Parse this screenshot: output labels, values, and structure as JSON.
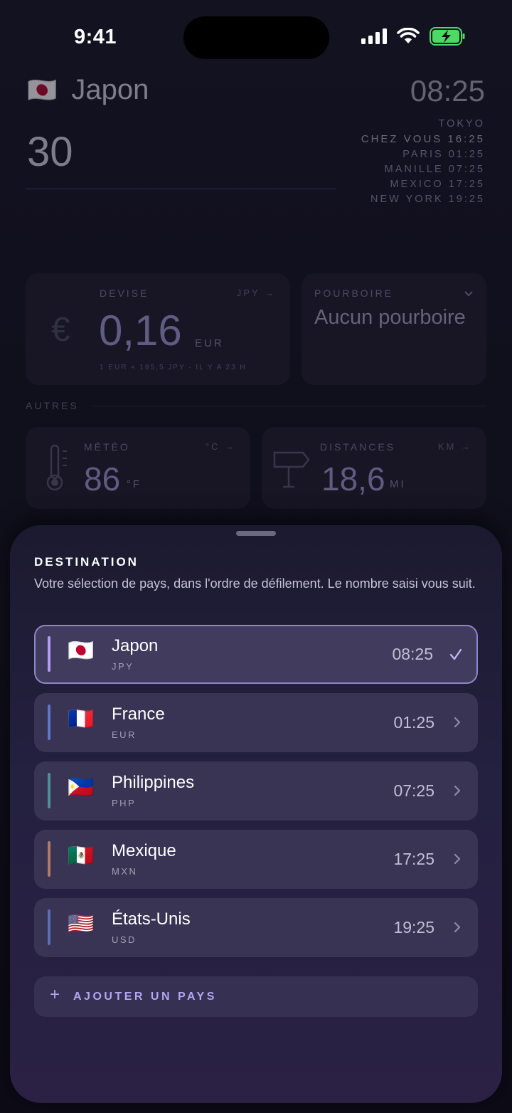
{
  "status_bar": {
    "time": "9:41"
  },
  "header": {
    "flag": "🇯🇵",
    "country": "Japon",
    "amount": "30",
    "clock": "08:25",
    "timezones": [
      {
        "label": "TOKYO",
        "time": ""
      },
      {
        "label": "CHEZ VOUS",
        "time": "16:25"
      },
      {
        "label": "PARIS",
        "time": "01:25"
      },
      {
        "label": "MANILLE",
        "time": "07:25"
      },
      {
        "label": "MEXICO",
        "time": "17:25"
      },
      {
        "label": "NEW YORK",
        "time": "19:25"
      }
    ]
  },
  "cards": {
    "currency": {
      "label": "DEVISE",
      "unit": "JPY →",
      "symbol": "€",
      "value": "0,16",
      "value_unit": "EUR",
      "note": "1 EUR ≈ 185,5 JPY  ·  IL Y A 23 H"
    },
    "tip": {
      "label": "POURBOIRE",
      "value": "Aucun pourboire"
    },
    "others_label": "AUTRES",
    "weather": {
      "label": "MÉTÉO",
      "unit": "°C →",
      "value": "86",
      "value_unit": "°F"
    },
    "distance": {
      "label": "DISTANCES",
      "unit": "KM →",
      "value": "18,6",
      "value_unit": "MI"
    }
  },
  "sheet": {
    "title": "DESTINATION",
    "description": "Votre sélection de pays, dans l'ordre de défilement. Le nombre saisi vous suit.",
    "countries": [
      {
        "flag": "🇯🇵",
        "name": "Japon",
        "code": "JPY",
        "time": "08:25",
        "selected": true,
        "bar_color": "#b19cf5"
      },
      {
        "flag": "🇫🇷",
        "name": "France",
        "code": "EUR",
        "time": "01:25",
        "selected": false,
        "bar_color": "#5d78c9"
      },
      {
        "flag": "🇵🇭",
        "name": "Philippines",
        "code": "PHP",
        "time": "07:25",
        "selected": false,
        "bar_color": "#4f8f96"
      },
      {
        "flag": "🇲🇽",
        "name": "Mexique",
        "code": "MXN",
        "time": "17:25",
        "selected": false,
        "bar_color": "#b27a6a"
      },
      {
        "flag": "🇺🇸",
        "name": "États-Unis",
        "code": "USD",
        "time": "19:25",
        "selected": false,
        "bar_color": "#5a6fb8"
      }
    ],
    "add_button": "AJOUTER UN PAYS"
  }
}
